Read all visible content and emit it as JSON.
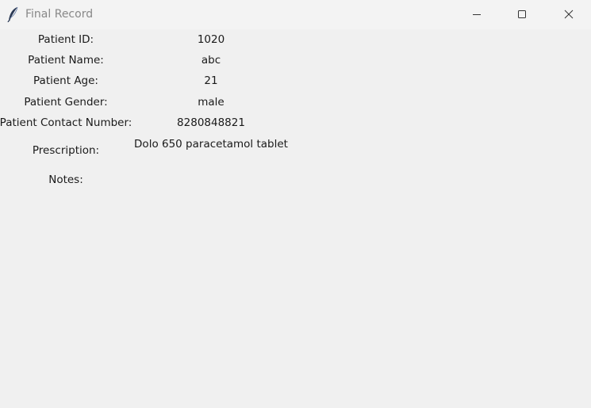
{
  "window": {
    "title": "Final Record",
    "icon": "feather-icon",
    "controls": {
      "minimize_icon": "minimize-icon",
      "maximize_icon": "maximize-icon",
      "close_icon": "close-icon"
    }
  },
  "record": {
    "id_label": "Patient ID:",
    "id_value": "1020",
    "name_label": "Patient Name:",
    "name_value": "abc",
    "age_label": "Patient Age:",
    "age_value": "21",
    "gender_label": "Patient Gender:",
    "gender_value": "male",
    "contact_label": "Patient Contact Number:",
    "contact_value": "8280848821",
    "prescription_label": "Prescription:",
    "prescription_value": "Dolo 650 paracetamol tablet",
    "notes_label": "Notes:",
    "notes_value": ""
  }
}
